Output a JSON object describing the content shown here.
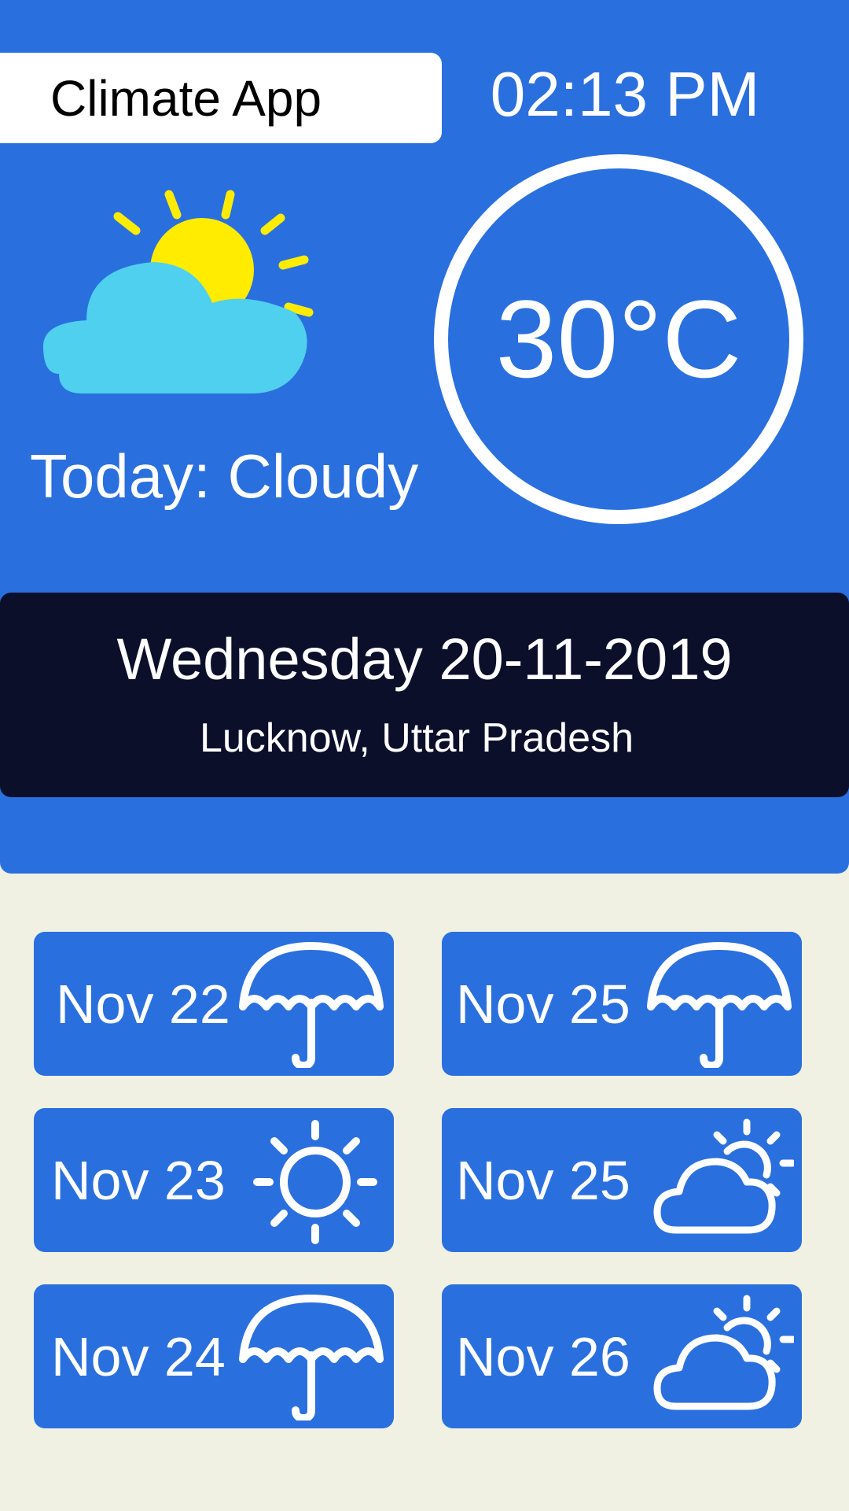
{
  "header": {
    "app_title": "Climate App",
    "time": "02:13 PM"
  },
  "current": {
    "condition_label": "Today: Cloudy",
    "temperature": "30°C",
    "icon": "sun-behind-cloud-icon"
  },
  "date_card": {
    "date": "Wednesday 20-11-2019",
    "location": "Lucknow, Uttar Pradesh"
  },
  "forecast": [
    {
      "day": "Nov 22",
      "icon": "umbrella-icon"
    },
    {
      "day": "Nov 25",
      "icon": "umbrella-icon"
    },
    {
      "day": "Nov 23",
      "icon": "sun-icon"
    },
    {
      "day": "Nov 25",
      "icon": "partly-cloudy-icon"
    },
    {
      "day": "Nov 24",
      "icon": "umbrella-icon"
    },
    {
      "day": "Nov 26",
      "icon": "partly-cloudy-icon"
    }
  ],
  "colors": {
    "primary": "#2a6fde",
    "dark_card": "#0b0f2a",
    "background": "#f0f0e3",
    "cloud": "#4fd0ef",
    "sun": "#ffec00"
  }
}
